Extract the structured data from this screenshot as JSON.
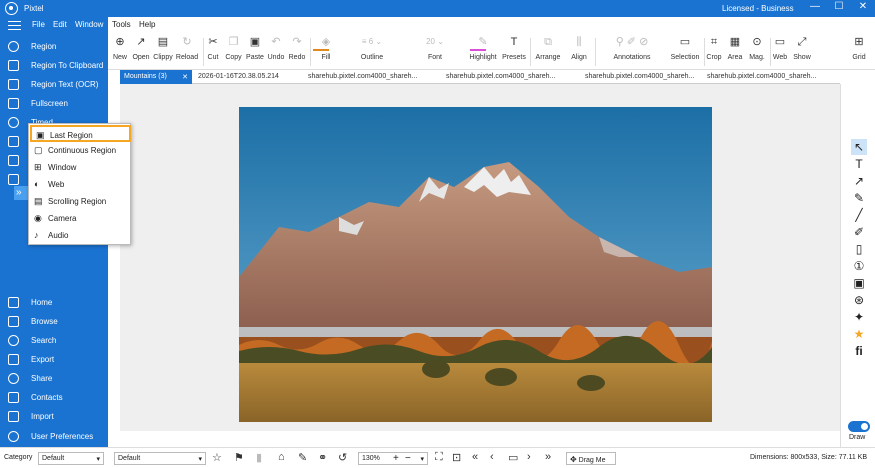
{
  "app": {
    "title": "Pixtel",
    "license": "Licensed - Business"
  },
  "window_controls": {
    "minimize": "—",
    "maximize": "☐",
    "close": "✕"
  },
  "menu": [
    "File",
    "Edit",
    "Window",
    "Tools",
    "Help"
  ],
  "sidebar": {
    "capture": [
      {
        "label": "Region",
        "icon": "plus-circle-icon"
      },
      {
        "label": "Region To Clipboard",
        "icon": "clipboard-icon"
      },
      {
        "label": "Region Text (OCR)",
        "icon": "ocr-text-icon"
      },
      {
        "label": "Fullscreen",
        "icon": "fullscreen-icon"
      },
      {
        "label": "Timed",
        "icon": "timer-icon"
      },
      {
        "label": "",
        "icon": "window-icon"
      },
      {
        "label": "",
        "icon": "document-icon"
      },
      {
        "label": "",
        "icon": "video-icon"
      },
      {
        "label": "»",
        "icon": "more-icon"
      }
    ],
    "nav": [
      {
        "label": "Home",
        "icon": "home-icon"
      },
      {
        "label": "Browse",
        "icon": "folder-icon"
      },
      {
        "label": "Search",
        "icon": "search-icon"
      },
      {
        "label": "Export",
        "icon": "export-icon"
      },
      {
        "label": "Share",
        "icon": "share-icon"
      },
      {
        "label": "Contacts",
        "icon": "contacts-icon"
      },
      {
        "label": "Import",
        "icon": "import-icon"
      },
      {
        "label": "User Preferences",
        "icon": "gear-icon"
      }
    ]
  },
  "toolbar": {
    "new": "New",
    "open": "Open",
    "clippy": "Clippy",
    "reload": "Reload",
    "cut": "Cut",
    "copy": "Copy",
    "paste": "Paste",
    "undo": "Undo",
    "redo": "Redo",
    "fill": "Fill",
    "outline": "Outline",
    "outline_size": "6",
    "font": "Font",
    "font_size": "20",
    "highlight": "Highlight",
    "presets": "Presets",
    "arrange": "Arrange",
    "align": "Align",
    "annotations": "Annotations",
    "selection": "Selection",
    "crop": "Crop",
    "area": "Area",
    "mag": "Mag.",
    "web": "Web",
    "show": "Show",
    "grid": "Grid",
    "fill_color": "#e08a1e",
    "highlight_color": "#d94fd6"
  },
  "tabs": [
    {
      "label": "Mountains (3)",
      "close": "✕",
      "active": true
    },
    {
      "label": "2026-01-16T20.38.05.214",
      "active": false
    },
    {
      "label": "sharehub.pixtel.com4000_shareh...",
      "active": false
    },
    {
      "label": "sharehub.pixtel.com4000_shareh...",
      "active": false
    },
    {
      "label": "sharehub.pixtel.com4000_shareh...",
      "active": false
    },
    {
      "label": "sharehub.pixtel.com4000_shareh...",
      "active": false
    }
  ],
  "dropdown": [
    {
      "label": "Last Region",
      "icon": "last-region-icon",
      "selected": true
    },
    {
      "label": "Continuous Region",
      "icon": "continuous-region-icon"
    },
    {
      "label": "Window",
      "icon": "windows-icon"
    },
    {
      "label": "Web",
      "icon": "web-icon"
    },
    {
      "label": "Scrolling Region",
      "icon": "scrolling-region-icon"
    },
    {
      "label": "Camera",
      "icon": "camera-icon"
    },
    {
      "label": "Audio",
      "icon": "audio-icon"
    }
  ],
  "right_tools": {
    "draw_label": "Draw"
  },
  "statusbar": {
    "category_label": "Category",
    "category_value": "Default",
    "second_value": "Default",
    "zoom": "130%",
    "drag_me": "Drag Me",
    "dimensions": "Dimensions: 800x533, Size: 77.11 KB"
  },
  "colors": {
    "accent": "#1a73d1",
    "highlight_border": "#f5a623"
  }
}
